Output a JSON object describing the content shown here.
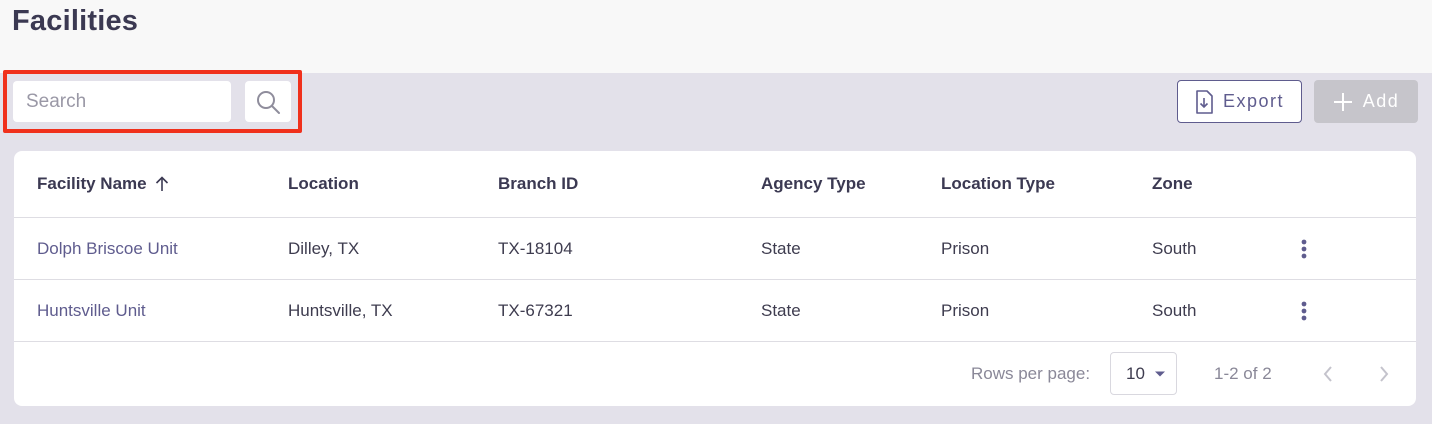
{
  "page": {
    "title": "Facilities"
  },
  "toolbar": {
    "search_placeholder": "Search",
    "search_value": "",
    "export_label": "Export",
    "add_label": "Add"
  },
  "colors": {
    "accent": "#5f5c8e",
    "highlight": "#f0301c",
    "page_bg": "#e3e1ea",
    "header_bg": "#f8f8f8",
    "disabled": "#c6c5cb"
  },
  "table": {
    "columns": [
      "Facility Name",
      "Location",
      "Branch ID",
      "Agency Type",
      "Location Type",
      "Zone"
    ],
    "sort": {
      "column": "Facility Name",
      "direction": "ascending",
      "icon": "arrow-up-icon"
    },
    "rows": [
      {
        "facility_name": "Dolph Briscoe Unit",
        "location": "Dilley, TX",
        "branch_id": "TX-18104",
        "agency_type": "State",
        "location_type": "Prison",
        "zone": "South"
      },
      {
        "facility_name": "Huntsville Unit",
        "location": "Huntsville, TX",
        "branch_id": "TX-67321",
        "agency_type": "State",
        "location_type": "Prison",
        "zone": "South"
      }
    ]
  },
  "pagination": {
    "rows_per_page_label": "Rows per page:",
    "rows_per_page_value": "10",
    "range_label": "1-2 of 2"
  },
  "icons": {
    "search": "search-icon",
    "export": "download-icon",
    "add": "plus-icon",
    "row_menu": "more-vertical-icon",
    "dropdown": "caret-down-icon",
    "prev": "chevron-left-icon",
    "next": "chevron-right-icon"
  }
}
